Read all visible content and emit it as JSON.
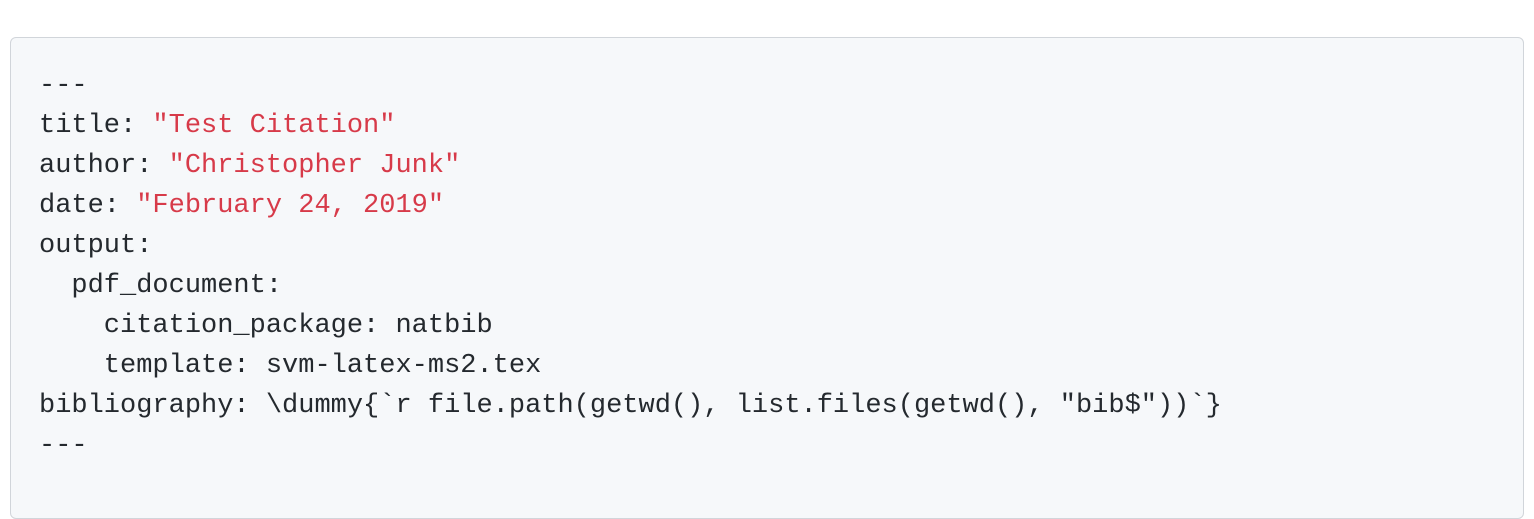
{
  "code": {
    "delim_open": "---",
    "line1_key": "title: ",
    "line1_val": "\"Test Citation\"",
    "line2_key": "author: ",
    "line2_val": "\"Christopher Junk\"",
    "line3_key": "date: ",
    "line3_val": "\"February 24, 2019\"",
    "line4": "output:",
    "line5": "  pdf_document:",
    "line6": "    citation_package: natbib",
    "line7": "    template: svm-latex-ms2.tex",
    "line8": "bibliography: \\dummy{`r file.path(getwd(), list.files(getwd(), \"bib$\"))`}",
    "delim_close": "---"
  }
}
